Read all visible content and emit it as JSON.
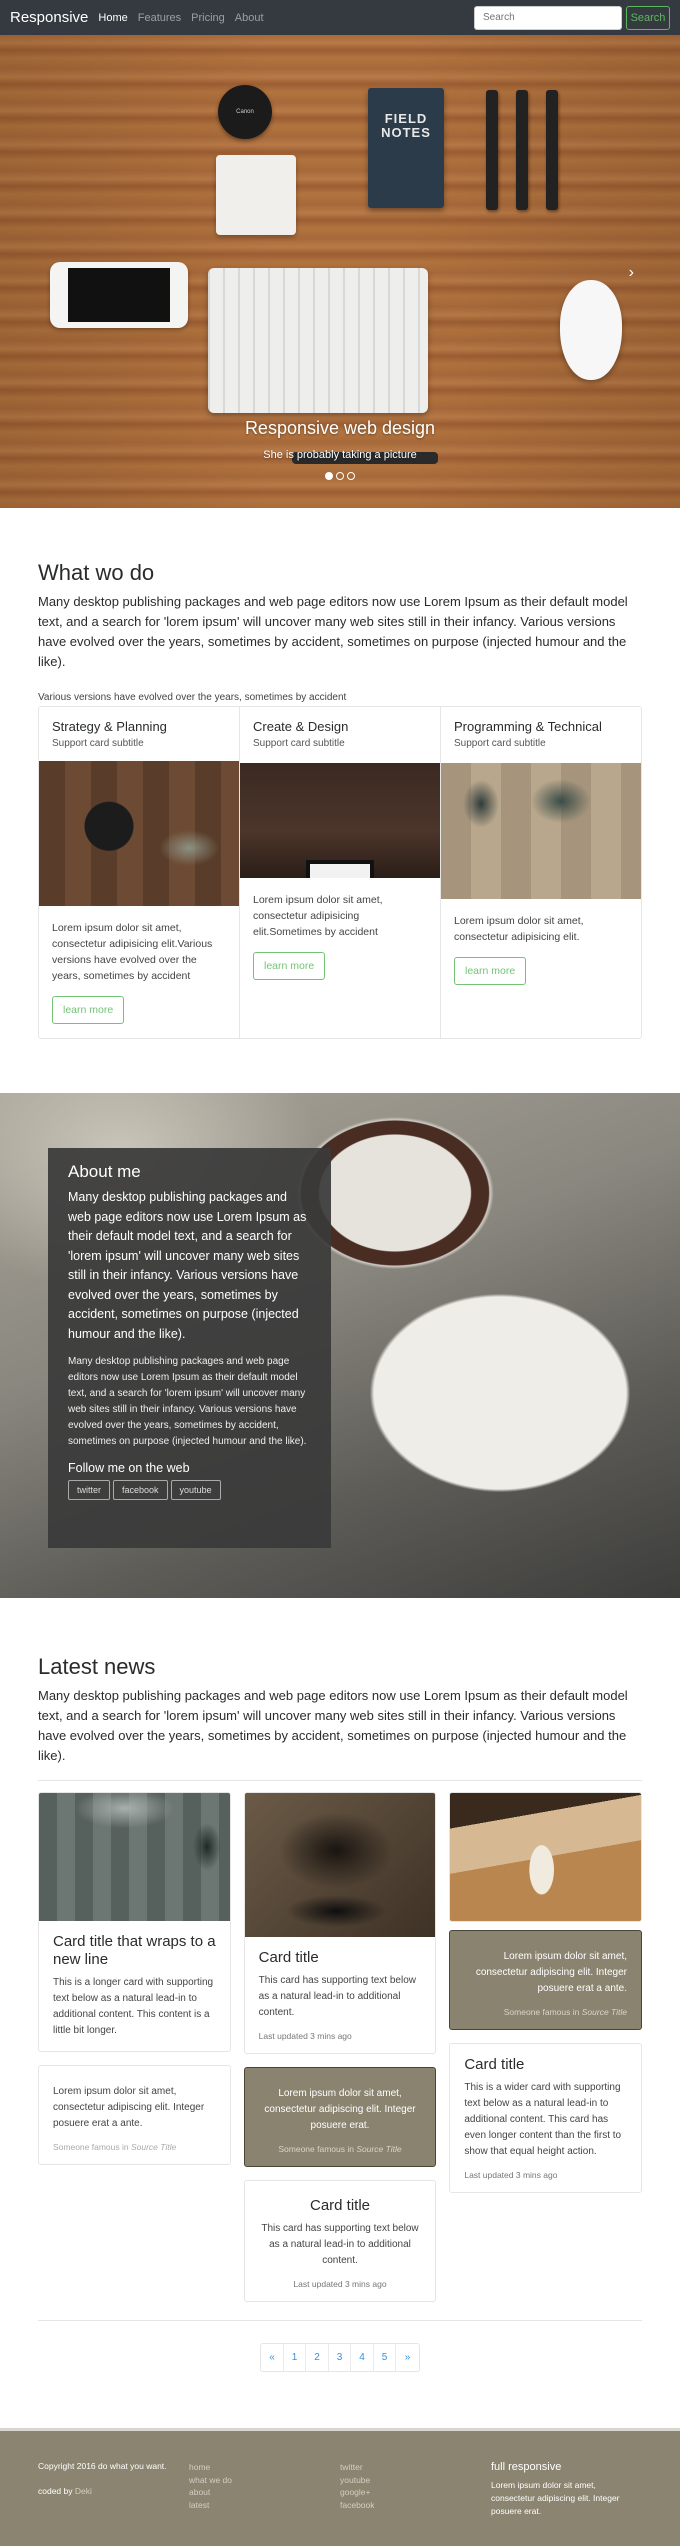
{
  "navbar": {
    "brand": "Responsive",
    "links": [
      "Home",
      "Features",
      "Pricing",
      "About"
    ],
    "active_index": 0,
    "search_placeholder": "Search",
    "search_button": "Search"
  },
  "hero": {
    "notebook_label": "FIELD NOTES",
    "lens_label": "Canon",
    "caption_title": "Responsive web design",
    "caption_text": "She is probably taking a picture",
    "slide_count": 3,
    "active_slide": 0,
    "next_icon": "chevron-right-icon",
    "prev_icon": "chevron-left-icon"
  },
  "what_we_do": {
    "title": "What wo do",
    "lead": "Many desktop publishing packages and web page editors now use Lorem Ipsum as their default model text, and a search for 'lorem ipsum' will uncover many web sites still in their infancy. Various versions have evolved over the years, sometimes by accident, sometimes on purpose (injected humour and the like).",
    "note": "Various versions have evolved over the years, sometimes by accident",
    "cards": [
      {
        "title": "Strategy & Planning",
        "subtitle": "Support card subtitle",
        "text": "Lorem ipsum dolor sit amet, consectetur adipisicing elit.Various versions have evolved over the years, sometimes by accident",
        "button": "learn more"
      },
      {
        "title": "Create & Design",
        "subtitle": "Support card subtitle",
        "text": "Lorem ipsum dolor sit amet, consectetur adipisicing elit.Sometimes by accident",
        "button": "learn more"
      },
      {
        "title": "Programming & Technical",
        "subtitle": "Support card subtitle",
        "text": "Lorem ipsum dolor sit amet, consectetur adipisicing elit.",
        "button": "learn more"
      }
    ]
  },
  "about": {
    "title": "About me",
    "lead": "Many desktop publishing packages and web page editors now use Lorem Ipsum as their default model text, and a search for 'lorem ipsum' will uncover many web sites still in their infancy. Various versions have evolved over the years, sometimes by accident, sometimes on purpose (injected humour and the like).",
    "text": "Many desktop publishing packages and web page editors now use Lorem Ipsum as their default model text, and a search for 'lorem ipsum' will uncover many web sites still in their infancy. Various versions have evolved over the years, sometimes by accident, sometimes on purpose (injected humour and the like).",
    "follow_title": "Follow me on the web",
    "social": [
      "twitter",
      "facebook",
      "youtube"
    ]
  },
  "news": {
    "title": "Latest news",
    "lead": "Many desktop publishing packages and web page editors now use Lorem Ipsum as their default model text, and a search for 'lorem ipsum' will uncover many web sites still in their infancy. Various versions have evolved over the years, sometimes by accident, sometimes on purpose (injected humour and the like).",
    "col1": {
      "card_title": "Card title that wraps to a new line",
      "card_text": "This is a longer card with supporting text below as a natural lead-in to additional content. This content is a little bit longer.",
      "quote_text": "Lorem ipsum dolor sit amet, consectetur adipiscing elit. Integer posuere erat a ante.",
      "quote_footer_prefix": "Someone famous in ",
      "quote_footer_source": "Source Title"
    },
    "col2": {
      "card_title": "Card title",
      "card_text": "This card has supporting text below as a natural lead-in to additional content.",
      "card_muted": "Last updated 3 mins ago",
      "quote_text": "Lorem ipsum dolor sit amet, consectetur adipiscing elit. Integer posuere erat.",
      "quote_footer_prefix": "Someone famous in ",
      "quote_footer_source": "Source Title",
      "card2_title": "Card title",
      "card2_text": "This card has supporting text below as a natural lead-in to additional content.",
      "card2_muted": "Last updated 3 mins ago"
    },
    "col3": {
      "quote_text": "Lorem ipsum dolor sit amet, consectetur adipiscing elit. Integer posuere erat a ante.",
      "quote_footer_prefix": "Someone famous in ",
      "quote_footer_source": "Source Title",
      "card_title": "Card title",
      "card_text": "This is a wider card with supporting text below as a natural lead-in to additional content. This card has even longer content than the first to show that equal height action.",
      "card_muted": "Last updated 3 mins ago"
    },
    "pagination": [
      "«",
      "1",
      "2",
      "3",
      "4",
      "5",
      "»"
    ]
  },
  "footer": {
    "copyright": "Copyright 2016 do what you want.",
    "coded_by_prefix": "coded by ",
    "coded_by_name": "Deki",
    "site_links": [
      "home",
      "what we do",
      "about",
      "latest"
    ],
    "social_links": [
      "twitter",
      "youtube",
      "google+",
      "facebook"
    ],
    "about_title": "full responsive",
    "about_text": "Lorem ipsum dolor sit amet, consectetur adipiscing elit. Integer posuere erat."
  },
  "colors": {
    "navbar_bg": "#343a40",
    "accent_green": "#5cb85c",
    "link_blue": "#0275d8",
    "inverse_card": "#8a8370",
    "footer_bg": "#8a8470"
  }
}
